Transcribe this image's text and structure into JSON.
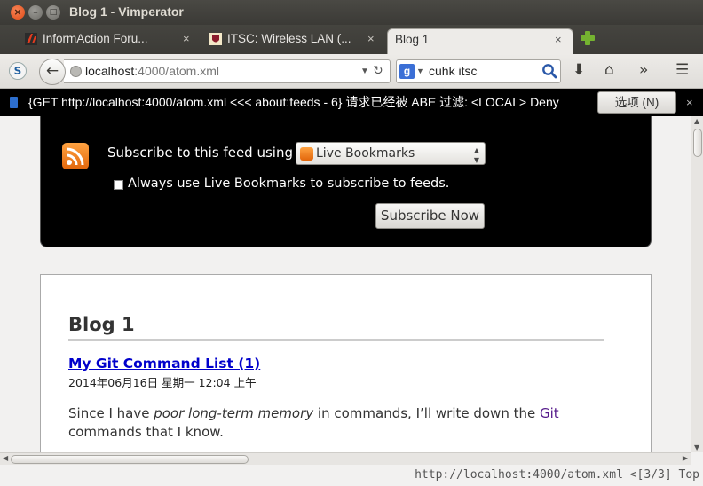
{
  "window": {
    "title": "Blog 1 - Vimperator"
  },
  "tabs": [
    {
      "label": "InformAction Foru...",
      "close": "×"
    },
    {
      "label": "ITSC: Wireless LAN (...",
      "close": "×"
    },
    {
      "label": "Blog 1",
      "close": "×"
    }
  ],
  "nav": {
    "url_host": "localhost",
    "url_rest": ":4000/atom.xml",
    "search_value": "cuhk itsc",
    "search_engine": "google-icon"
  },
  "notification": {
    "text": "{GET http://localhost:4000/atom.xml <<< about:feeds - 6} 请求已经被 ABE 过滤: <LOCAL> Deny",
    "button": "选项 (N)",
    "close": "×"
  },
  "feed": {
    "subscribe_label": "Subscribe to this feed using",
    "reader_selected": "Live Bookmarks",
    "always_use_label": "Always use Live Bookmarks to subscribe to feeds.",
    "subscribe_button": "Subscribe Now"
  },
  "article": {
    "blog_title": "Blog 1",
    "post_title": "My Git Command List (1)",
    "post_date": "2014年06月16日 星期一 12:04 上午",
    "body_before": "Since I have ",
    "body_em": "poor long-term memory",
    "body_mid": " in commands, I’ll write down the ",
    "body_link": "Git",
    "body_after": " commands that I know."
  },
  "status": {
    "text": "http://localhost:4000/atom.xml <[3/3] Top"
  },
  "colors": {
    "titlebar": "#3c3b37",
    "rss": "#f08a24",
    "link": "#0000cc",
    "visited": "#551a8b"
  }
}
